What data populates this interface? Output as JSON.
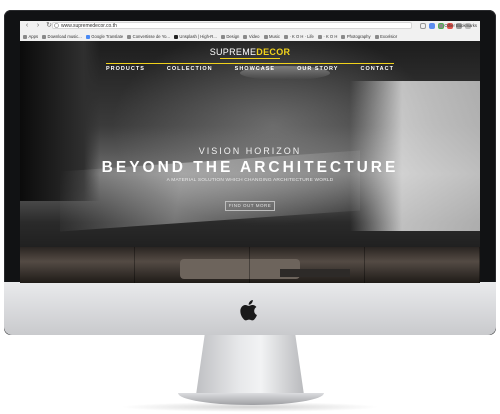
{
  "browser": {
    "url": "www.supremedecor.co.th",
    "nav_back": "‹",
    "nav_forward": "›",
    "nav_reload": "↻",
    "bookmarks": [
      {
        "icon": "apps-icon",
        "label": "Apps"
      },
      {
        "icon": "bookmark-icon",
        "label": "Download music..."
      },
      {
        "icon": "translate-icon",
        "label": "Google Translate"
      },
      {
        "icon": "bookmark-icon",
        "label": "Convertisse de Yo..."
      },
      {
        "icon": "camera-icon",
        "label": "Unsplash | High-R..."
      },
      {
        "icon": "folder-icon",
        "label": "Design"
      },
      {
        "icon": "folder-icon",
        "label": "Video"
      },
      {
        "icon": "folder-icon",
        "label": "Music"
      },
      {
        "icon": "bookmark-icon",
        "label": "· K O H · Life"
      },
      {
        "icon": "bookmark-icon",
        "label": "· K O H"
      },
      {
        "icon": "folder-icon",
        "label": "Photography"
      },
      {
        "icon": "bookmark-icon",
        "label": "Excelsior"
      }
    ],
    "other_bookmarks": "Other Bookmarks"
  },
  "site": {
    "logo_primary": "SUPREME",
    "logo_accent": "DECOR",
    "nav": [
      "PRODUCTS",
      "COLLECTION",
      "SHOWCASE",
      "OUR STORY",
      "CONTACT"
    ],
    "hero_subtitle": "VISION HORIZON",
    "hero_title": "BEYOND THE ARCHITECTURE",
    "hero_description": "A MATERIAL SOLUTION WHICH CHANGING ARCHITECTURE WORLD",
    "cta": "FIND OUT MORE"
  },
  "colors": {
    "accent": "#f1d21b",
    "bezel": "#111214",
    "chin": "#d9dadd"
  }
}
